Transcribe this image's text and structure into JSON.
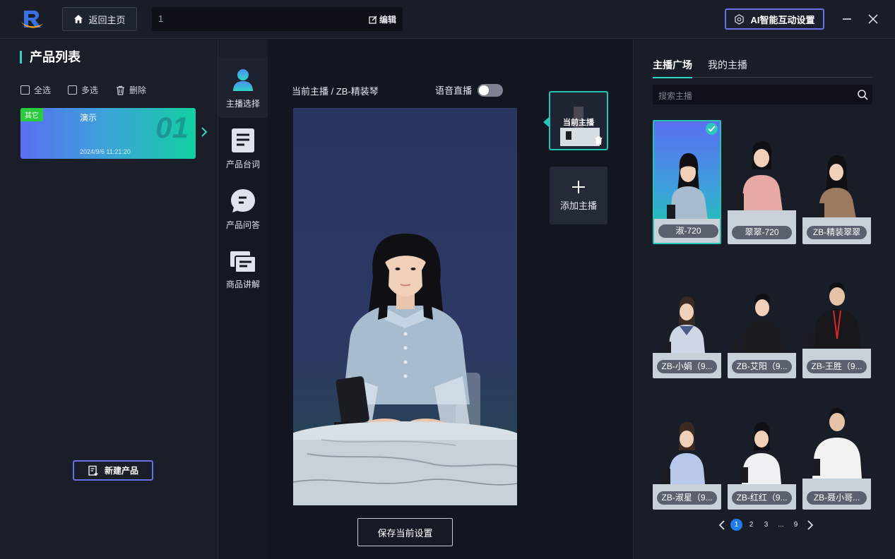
{
  "header": {
    "home_label": "返回主页",
    "product_name_value": "1",
    "edit_label": "编辑",
    "ai_settings_label": "AI智能互动设置"
  },
  "left_panel": {
    "title": "产品列表",
    "select_all_label": "全选",
    "multi_select_label": "多选",
    "delete_label": "删除",
    "products": [
      {
        "badge": "其它",
        "name": "演示",
        "number": "01",
        "date": "2024/9/6 11:21:20"
      }
    ],
    "new_product_label": "新建产品"
  },
  "nav": {
    "items": [
      {
        "label": "主播选择",
        "icon": "person-icon",
        "active": true
      },
      {
        "label": "产品台词",
        "icon": "document-icon",
        "active": false
      },
      {
        "label": "产品问答",
        "icon": "chat-icon",
        "active": false
      },
      {
        "label": "商品讲解",
        "icon": "slides-icon",
        "active": false
      }
    ]
  },
  "center": {
    "current_anchor_label": "当前主播 / ZB-精装琴",
    "voice_live_label": "语音直播",
    "voice_live_on": false,
    "current_thumb_label": "当前主播",
    "add_anchor_label": "添加主播",
    "save_label": "保存当前设置"
  },
  "right_panel": {
    "tabs": [
      {
        "label": "主播广场",
        "active": true
      },
      {
        "label": "我的主播",
        "active": false
      }
    ],
    "search_placeholder": "搜索主播",
    "anchors": [
      {
        "name": "淑-720",
        "selected": true
      },
      {
        "name": "翠翠-720",
        "selected": false
      },
      {
        "name": "ZB-精装翠翠",
        "selected": false
      },
      {
        "name": "ZB-小娟（9...",
        "selected": false
      },
      {
        "name": "ZB-艾阳（9...",
        "selected": false
      },
      {
        "name": "ZB-王胜（9...",
        "selected": false
      },
      {
        "name": "ZB-淑星（9...",
        "selected": false
      },
      {
        "name": "ZB-红红（9...",
        "selected": false
      },
      {
        "name": "ZB-聂小哥...",
        "selected": false
      }
    ],
    "pagination": {
      "pages": [
        "1",
        "2",
        "3",
        "...",
        "9"
      ],
      "current": "1"
    }
  },
  "colors": {
    "accent_teal": "#2fd3c3",
    "accent_purple": "#6d6ee6",
    "page_active": "#1f7ce8",
    "badge_green": "#2bcb3e"
  }
}
